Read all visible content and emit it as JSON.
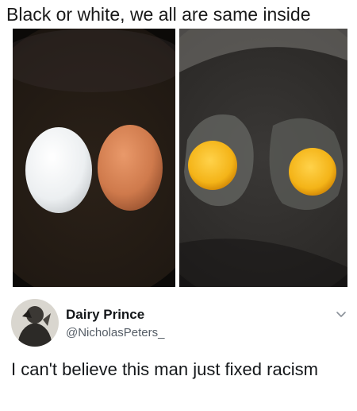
{
  "caption": "Black or white, we all are same inside",
  "images": {
    "left": {
      "icon": "two-whole-eggs-white-and-brown"
    },
    "right": {
      "icon": "two-fried-egg-yolks"
    }
  },
  "tweet": {
    "author_name": "Dairy Prince",
    "author_handle": "@NicholasPeters_",
    "text": "I can't believe this man just fixed racism",
    "menu_icon": "chevron-down-icon",
    "avatar_icon": "avatar"
  },
  "colors": {
    "white_egg": "#f2f3f4",
    "brown_egg": "#cf7a4c",
    "yolk": "#f4b418",
    "pan": "#221a13",
    "text_dark": "#14171a",
    "text_muted": "#555d66"
  }
}
